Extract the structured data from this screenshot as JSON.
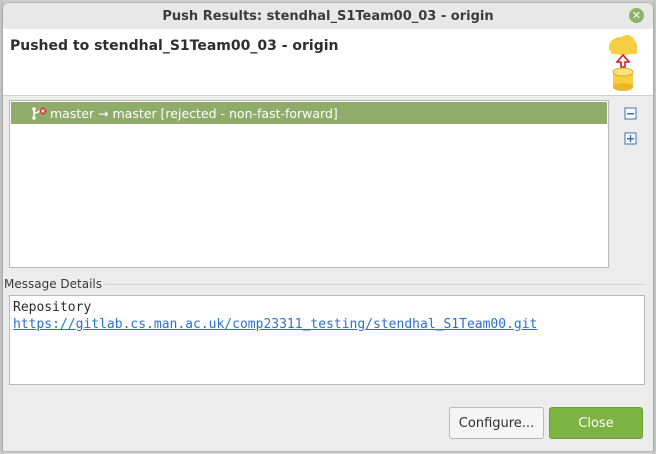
{
  "window": {
    "title": "Push Results: stendhal_S1Team00_03 - origin"
  },
  "header": {
    "title": "Pushed to stendhal_S1Team00_03 - origin"
  },
  "results": [
    {
      "label": "master → master [rejected - non-fast-forward]"
    }
  ],
  "message": {
    "label": "Message Details",
    "repo_label": "Repository",
    "repo_url": "https://gitlab.cs.man.ac.uk/comp23311_testing/stendhal_S1Team00.git"
  },
  "buttons": {
    "configure": "Configure...",
    "close": "Close"
  },
  "colors": {
    "selected_row": "#8fac6a",
    "close_button": "#7cb342",
    "link": "#2e6fd0"
  },
  "icons": [
    "close-icon",
    "push-cloud-database-icon",
    "rejected-branch-icon",
    "collapse-all-icon",
    "expand-all-icon"
  ]
}
